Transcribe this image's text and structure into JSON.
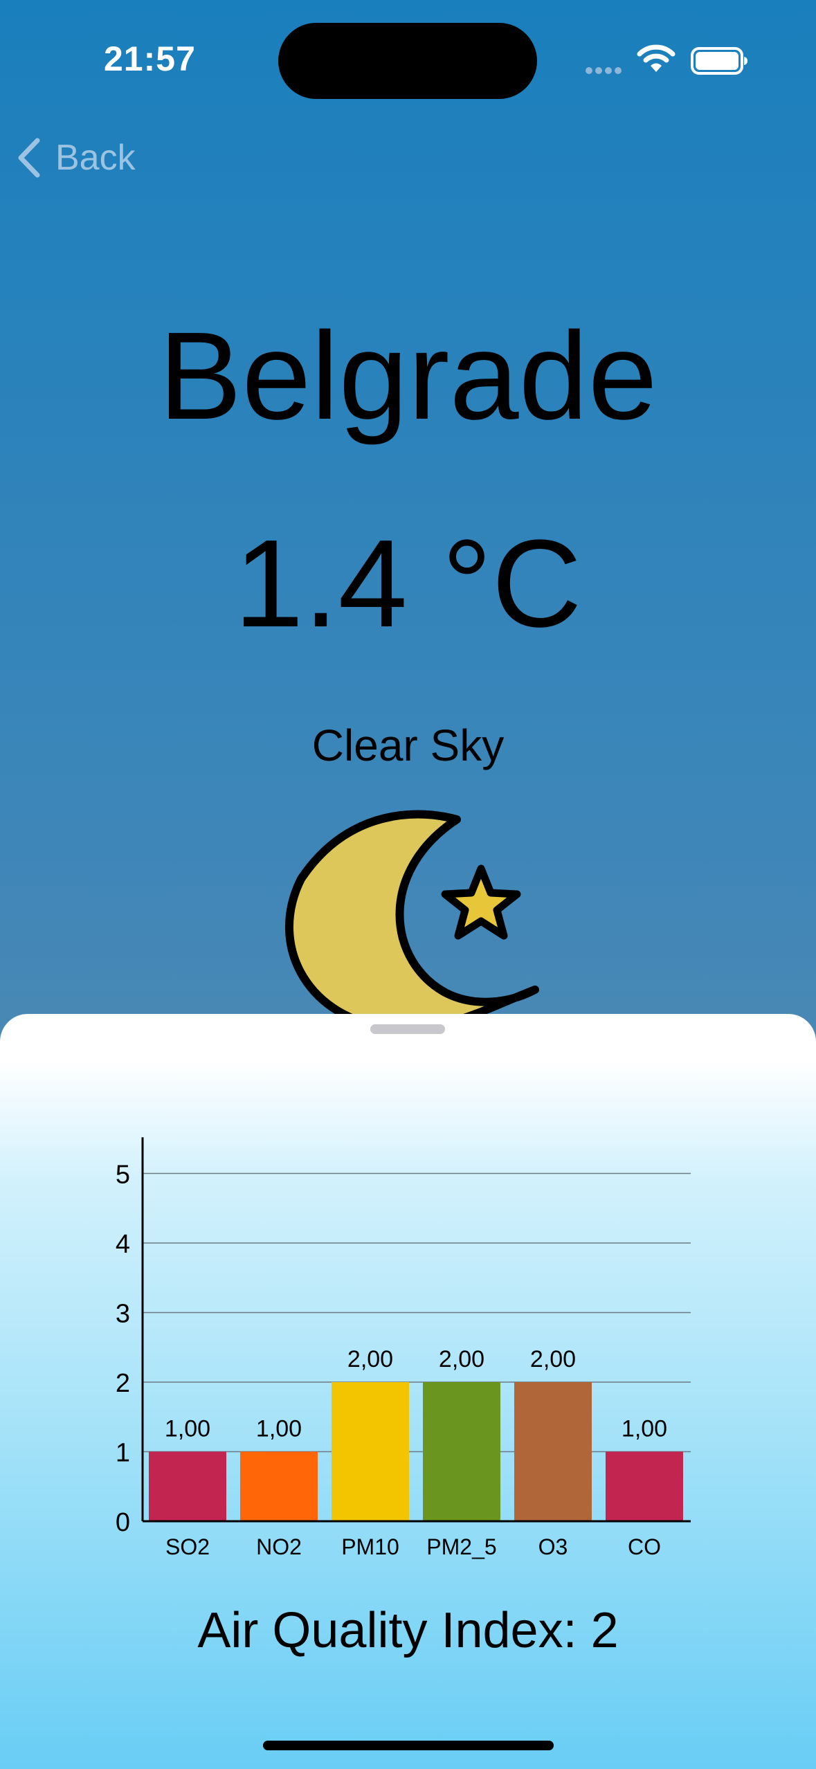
{
  "status_bar": {
    "time": "21:57"
  },
  "nav": {
    "back_label": "Back"
  },
  "weather": {
    "city": "Belgrade",
    "temperature": "1.4 °C",
    "condition": "Clear Sky",
    "icon": "moon-star-icon"
  },
  "chart_data": {
    "type": "bar",
    "categories": [
      "SO2",
      "NO2",
      "PM10",
      "PM2_5",
      "O3",
      "CO"
    ],
    "values": [
      1,
      1,
      2,
      2,
      2,
      1
    ],
    "value_labels": [
      "1,00",
      "1,00",
      "2,00",
      "2,00",
      "2,00",
      "1,00"
    ],
    "colors": [
      "#c2254f",
      "#ff6608",
      "#f3c400",
      "#6a9620",
      "#b06638",
      "#c2254f"
    ],
    "ylim": [
      0,
      5.5
    ],
    "yticks": [
      "0",
      "1",
      "2",
      "3",
      "4",
      "5"
    ],
    "grid": true
  },
  "aqi": {
    "label": "Air Quality Index: 2"
  }
}
